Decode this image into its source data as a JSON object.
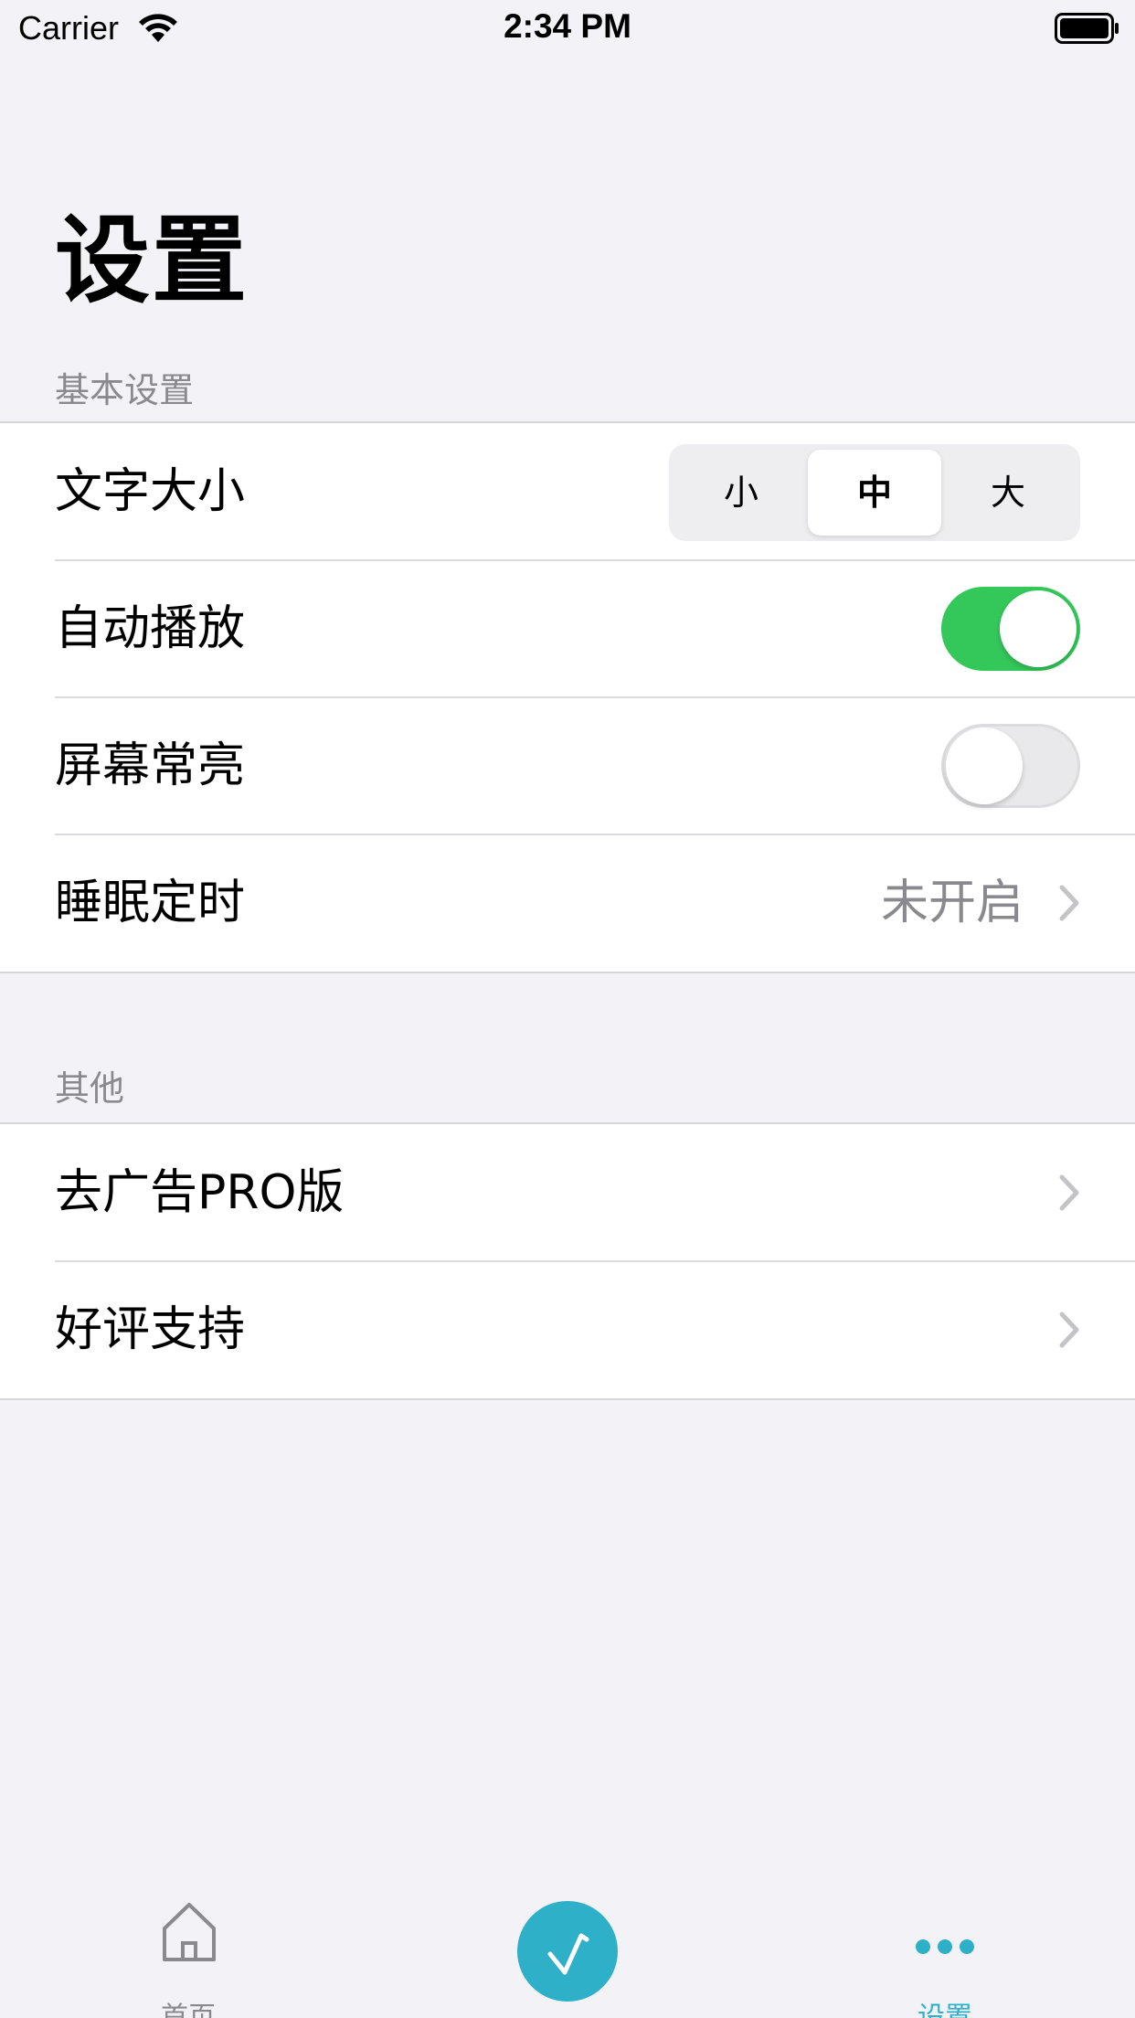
{
  "status_bar": {
    "carrier": "Carrier",
    "time": "2:34 PM"
  },
  "title": "设置",
  "sections": {
    "basic": {
      "header": "基本设置",
      "text_size": {
        "label": "文字大小",
        "options": [
          "小",
          "中",
          "大"
        ],
        "selected": "中"
      },
      "autoplay": {
        "label": "自动播放",
        "on": true
      },
      "screen_awake": {
        "label": "屏幕常亮",
        "on": false
      },
      "sleep_timer": {
        "label": "睡眠定时",
        "value": "未开启"
      }
    },
    "other": {
      "header": "其他",
      "remove_ads": {
        "label": "去广告PRO版"
      },
      "rate": {
        "label": "好评支持"
      }
    }
  },
  "tab_bar": {
    "home": {
      "label": "首页",
      "icon": "home-icon"
    },
    "center": {
      "icon": "music-note-icon",
      "color": "#2fb0c9"
    },
    "settings": {
      "label": "设置",
      "icon": "more-dots-icon",
      "active": true
    }
  },
  "colors": {
    "accent": "#2fb0c9",
    "toggle_on": "#34c759",
    "secondary_text": "#8a8a8e"
  }
}
